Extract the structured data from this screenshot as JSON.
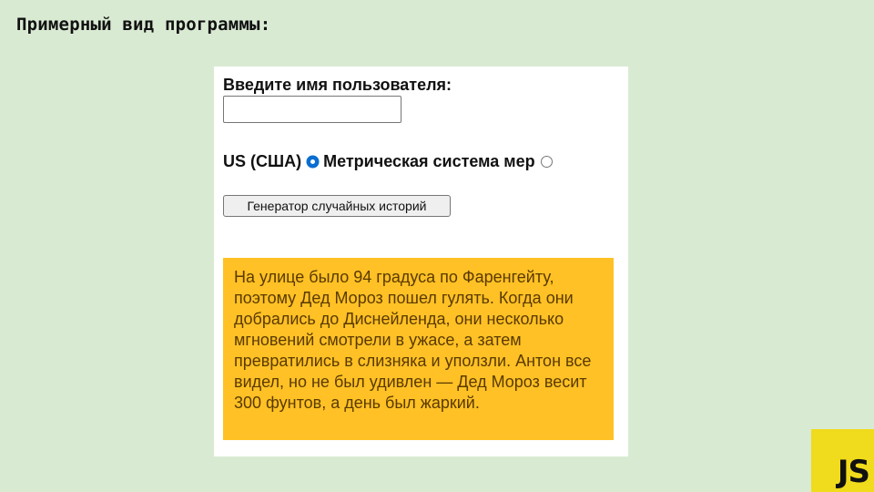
{
  "slide": {
    "title": "Примерный вид программы:"
  },
  "app": {
    "prompt_label": "Введите имя пользователя:",
    "name_input": {
      "value": "",
      "placeholder": ""
    },
    "units": {
      "us_label": "US (США)",
      "us_checked": true,
      "metric_label": "Метрическая система мер",
      "metric_checked": false
    },
    "generate_button_label": "Генератор случайных историй",
    "story_text": "На улице было 94 градуса по Фаренгейту, поэтому Дед Мороз пошел гулять. Когда они добрались до Диснейленда, они несколько мгновений смотрели в ужасе, а затем превратились в слизняка и уползли. Антон все видел, но не был удивлен — Дед Мороз весит 300 фунтов, а день был жаркий.",
    "colors": {
      "story_background": "#ffc125",
      "story_text": "#5a3a00",
      "slide_background": "#d9ead3"
    }
  },
  "logo": {
    "text": "JS",
    "color": "#f0db1c"
  }
}
